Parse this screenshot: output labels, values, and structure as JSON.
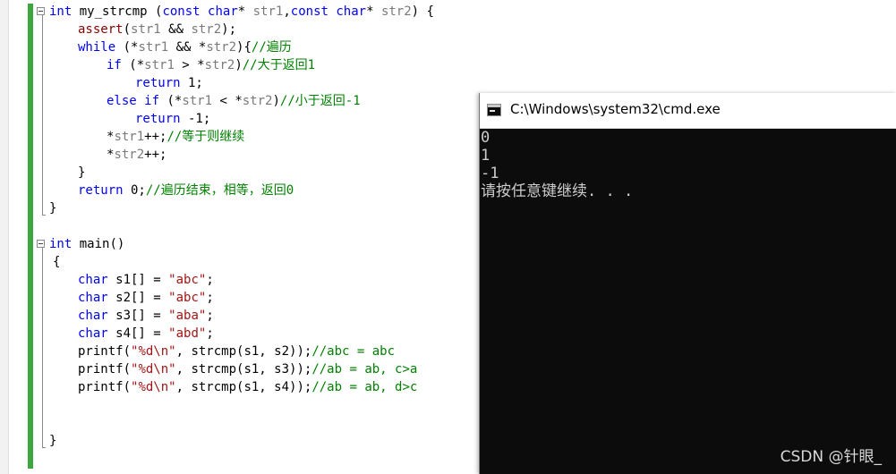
{
  "editor": {
    "lines": [
      {
        "id": "l1",
        "tokens": [
          [
            "kw",
            "int"
          ],
          [
            "id",
            " my_strcmp "
          ],
          [
            "id",
            "("
          ],
          [
            "kw",
            "const"
          ],
          [
            "id",
            " "
          ],
          [
            "kw",
            "char"
          ],
          [
            "id",
            "* "
          ],
          [
            "var",
            "str1"
          ],
          [
            "id",
            ","
          ],
          [
            "kw",
            "const"
          ],
          [
            "id",
            " "
          ],
          [
            "kw",
            "char"
          ],
          [
            "id",
            "* "
          ],
          [
            "var",
            "str2"
          ],
          [
            "id",
            ") {"
          ]
        ]
      },
      {
        "id": "l2",
        "tokens": [
          [
            "fn",
            "assert"
          ],
          [
            "id",
            "("
          ],
          [
            "var",
            "str1"
          ],
          [
            "id",
            " && "
          ],
          [
            "var",
            "str2"
          ],
          [
            "id",
            ");"
          ]
        ]
      },
      {
        "id": "l3",
        "tokens": [
          [
            "kw",
            "while"
          ],
          [
            "id",
            " (*"
          ],
          [
            "var",
            "str1"
          ],
          [
            "id",
            " && *"
          ],
          [
            "var",
            "str2"
          ],
          [
            "id",
            "){"
          ],
          [
            "cm",
            "//遍历"
          ]
        ]
      },
      {
        "id": "l4",
        "tokens": [
          [
            "kw",
            "if"
          ],
          [
            "id",
            " (*"
          ],
          [
            "var",
            "str1"
          ],
          [
            "id",
            " > *"
          ],
          [
            "var",
            "str2"
          ],
          [
            "id",
            ")"
          ],
          [
            "cm",
            "//大于返回1"
          ]
        ]
      },
      {
        "id": "l5",
        "tokens": [
          [
            "kw",
            "return"
          ],
          [
            "id",
            " 1;"
          ]
        ]
      },
      {
        "id": "l6",
        "tokens": [
          [
            "kw",
            "else"
          ],
          [
            "id",
            " "
          ],
          [
            "kw",
            "if"
          ],
          [
            "id",
            " (*"
          ],
          [
            "var",
            "str1"
          ],
          [
            "id",
            " < *"
          ],
          [
            "var",
            "str2"
          ],
          [
            "id",
            ")"
          ],
          [
            "cm",
            "//小于返回-1"
          ]
        ]
      },
      {
        "id": "l7",
        "tokens": [
          [
            "kw",
            "return"
          ],
          [
            "id",
            " -1;"
          ]
        ]
      },
      {
        "id": "l8",
        "tokens": [
          [
            "id",
            "*"
          ],
          [
            "var",
            "str1"
          ],
          [
            "id",
            "++;"
          ],
          [
            "cm",
            "//等于则继续"
          ]
        ]
      },
      {
        "id": "l9",
        "tokens": [
          [
            "id",
            "*"
          ],
          [
            "var",
            "str2"
          ],
          [
            "id",
            "++;"
          ]
        ]
      },
      {
        "id": "l10",
        "tokens": [
          [
            "id",
            "}"
          ]
        ]
      },
      {
        "id": "l11",
        "tokens": [
          [
            "kw",
            "return"
          ],
          [
            "id",
            " 0;"
          ],
          [
            "cm",
            "//遍历结束，相等，返回0"
          ]
        ]
      },
      {
        "id": "l12",
        "tokens": [
          [
            "id",
            "}"
          ]
        ]
      },
      {
        "id": "l14",
        "tokens": [
          [
            "kw",
            "int"
          ],
          [
            "id",
            " main()"
          ]
        ]
      },
      {
        "id": "l15",
        "tokens": [
          [
            "id",
            "{"
          ]
        ]
      },
      {
        "id": "l16",
        "tokens": [
          [
            "kw",
            "char"
          ],
          [
            "id",
            " s1[] = "
          ],
          [
            "str",
            "\"abc\""
          ],
          [
            "id",
            ";"
          ]
        ]
      },
      {
        "id": "l17",
        "tokens": [
          [
            "kw",
            "char"
          ],
          [
            "id",
            " s2[] = "
          ],
          [
            "str",
            "\"abc\""
          ],
          [
            "id",
            ";"
          ]
        ]
      },
      {
        "id": "l18",
        "tokens": [
          [
            "kw",
            "char"
          ],
          [
            "id",
            " s3[] = "
          ],
          [
            "str",
            "\"aba\""
          ],
          [
            "id",
            ";"
          ]
        ]
      },
      {
        "id": "l19",
        "tokens": [
          [
            "kw",
            "char"
          ],
          [
            "id",
            " s4[] = "
          ],
          [
            "str",
            "\"abd\""
          ],
          [
            "id",
            ";"
          ]
        ]
      },
      {
        "id": "l20",
        "tokens": [
          [
            "id",
            "printf("
          ],
          [
            "str",
            "\"%d\\n\""
          ],
          [
            "id",
            ", strcmp(s1, s2));"
          ],
          [
            "cm",
            "//abc = abc"
          ]
        ]
      },
      {
        "id": "l21",
        "tokens": [
          [
            "id",
            "printf("
          ],
          [
            "str",
            "\"%d\\n\""
          ],
          [
            "id",
            ", strcmp(s1, s3));"
          ],
          [
            "cm",
            "//ab = ab, c>a"
          ]
        ]
      },
      {
        "id": "l22",
        "tokens": [
          [
            "id",
            "printf("
          ],
          [
            "str",
            "\"%d\\n\""
          ],
          [
            "id",
            ", strcmp(s1, s4));"
          ],
          [
            "cm",
            "//ab = ab, d>c"
          ]
        ]
      },
      {
        "id": "l26",
        "tokens": [
          [
            "id",
            "}"
          ]
        ]
      }
    ]
  },
  "console": {
    "icon": "console-window-icon",
    "title": "C:\\Windows\\system32\\cmd.exe",
    "output": [
      "0",
      "1",
      "-1",
      "请按任意键继续. . ."
    ]
  },
  "watermark": "CSDN @针眼_",
  "colors": {
    "keyword": "#0000ff",
    "function": "#880000",
    "string": "#a31515",
    "comment": "#008000",
    "parameter": "#7a7a7a",
    "console_bg": "#0c0c0c",
    "console_text": "#cccccc",
    "change_bar": "#3ea63e"
  }
}
